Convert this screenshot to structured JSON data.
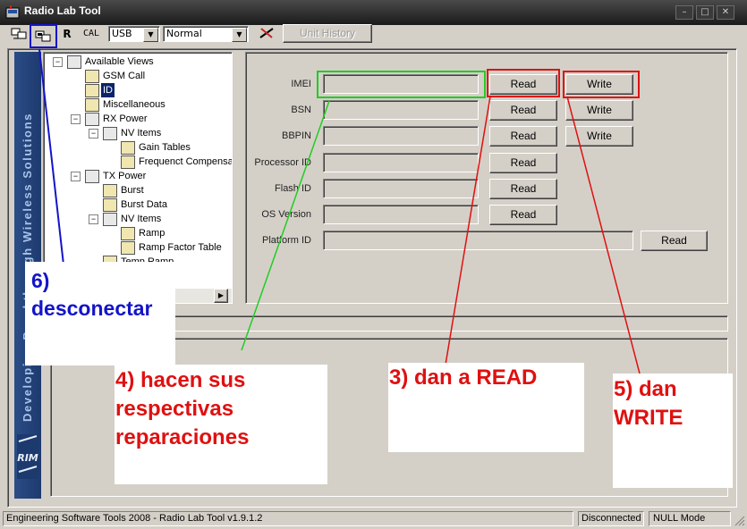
{
  "window": {
    "title": "Radio Lab Tool"
  },
  "toolbar": {
    "r_label": "R",
    "cal_label": "CAL",
    "port": "USB",
    "mode": "Normal",
    "unit_history": "Unit History"
  },
  "tree": {
    "items": [
      "Available Views",
      "GSM Call",
      "ID",
      "Miscellaneous",
      "RX Power",
      "NV Items",
      "Gain Tables",
      "Frequenct Compensat",
      "TX Power",
      "Burst",
      "Burst Data",
      "NV Items",
      "Ramp",
      "Ramp Factor Table",
      "Temp Ramp"
    ]
  },
  "sidebar": {
    "slogan": "Developing Breakthrough Wireless Solutions",
    "logo": "RIM"
  },
  "form": {
    "rows": [
      {
        "label": "IMEI",
        "read": "Read",
        "write": "Write"
      },
      {
        "label": "BSN",
        "read": "Read",
        "write": "Write"
      },
      {
        "label": "BBPIN",
        "read": "Read",
        "write": "Write"
      },
      {
        "label": "Processor ID",
        "read": "Read"
      },
      {
        "label": "Flash ID",
        "read": "Read"
      },
      {
        "label": "OS Version",
        "read": "Read"
      },
      {
        "label": "Platform ID",
        "read": "Read"
      }
    ]
  },
  "annotations": {
    "step6": [
      "6)",
      "desconectar"
    ],
    "step4": [
      "4) hacen sus",
      "respectivas",
      "reparaciones"
    ],
    "step3": "3) dan a READ",
    "step5": [
      "5) dan",
      "WRITE"
    ],
    "colors": {
      "blue": "#1414c8",
      "red": "#e01010",
      "green": "#22cc22"
    }
  },
  "status": {
    "app": "Engineering Software Tools 2008 - Radio Lab Tool v1.9.1.2",
    "connection": "Disconnected",
    "mode": "NULL Mode"
  }
}
